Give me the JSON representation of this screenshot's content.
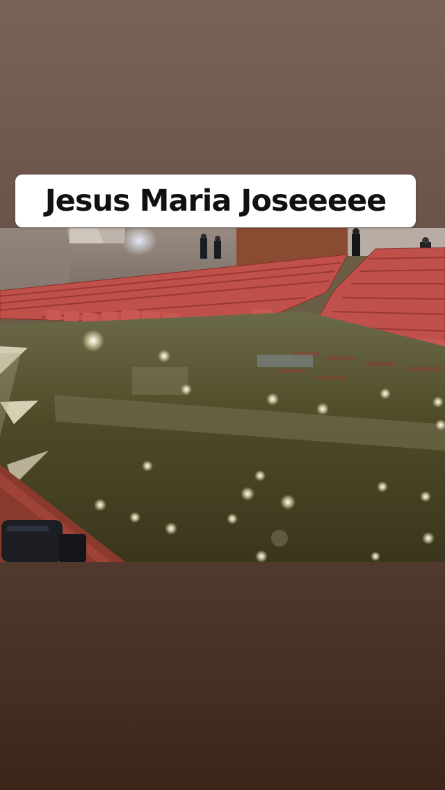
{
  "story": {
    "caption": "Jesus Maria Joseeeee",
    "background_top": "#7a6258",
    "background_bottom": "#3b2519"
  },
  "photo": {
    "subject": "flooded-auditorium",
    "colors": {
      "seat": "#c0504a",
      "water": "#4f4a2a",
      "wall": "#8a7c72",
      "wood_panel": "#8b4a32"
    }
  }
}
